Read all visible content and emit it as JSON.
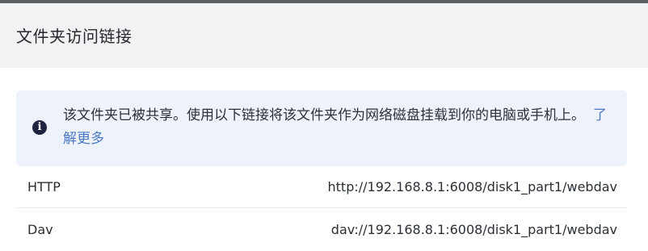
{
  "dialog": {
    "title": "文件夹访问链接"
  },
  "info": {
    "icon": "info-icon",
    "text": "该文件夹已被共享。使用以下链接将该文件夹作为网络磁盘挂载到你的电脑或手机上。",
    "link_label": "了解更多"
  },
  "links": [
    {
      "label": "HTTP",
      "url": "http://192.168.8.1:6008/disk1_part1/webdav"
    },
    {
      "label": "Dav",
      "url": "dav://192.168.8.1:6008/disk1_part1/webdav"
    }
  ],
  "colors": {
    "accent_link": "#4a78c6",
    "info_bg": "#eef2fb",
    "header_bg": "#f2f2f4"
  }
}
